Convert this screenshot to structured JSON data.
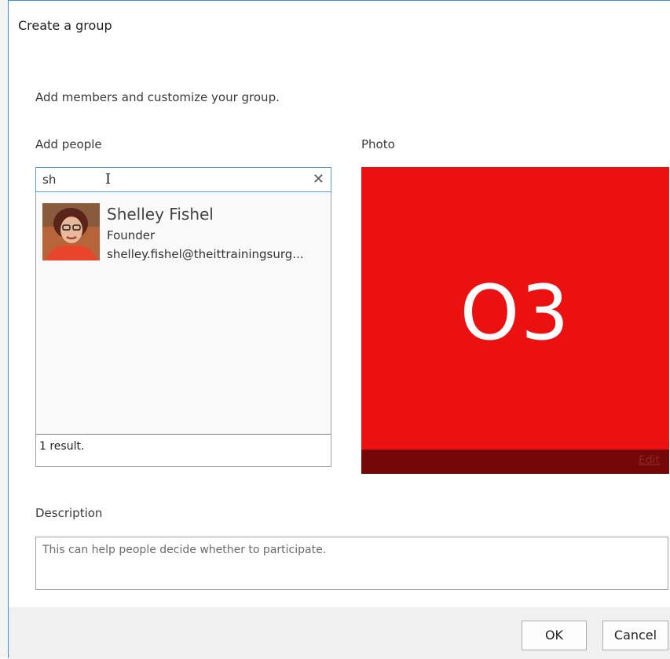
{
  "dialog": {
    "title": "Create a group",
    "intro": "Add members and customize your group."
  },
  "add_people": {
    "label": "Add people",
    "search_value": "sh",
    "clear_icon": "close-icon",
    "results": [
      {
        "name": "Shelley Fishel",
        "title": "Founder",
        "email": "shelley.fishel@theittrainingsurg..."
      }
    ],
    "result_count": "1 result."
  },
  "photo": {
    "label": "Photo",
    "initials": "O3",
    "edit_label": "Edit",
    "color": "#ec1111",
    "bar_color": "#740707"
  },
  "description": {
    "label": "Description",
    "placeholder": "This can help people decide whether to participate."
  },
  "footer": {
    "ok_label": "OK",
    "cancel_label": "Cancel"
  }
}
